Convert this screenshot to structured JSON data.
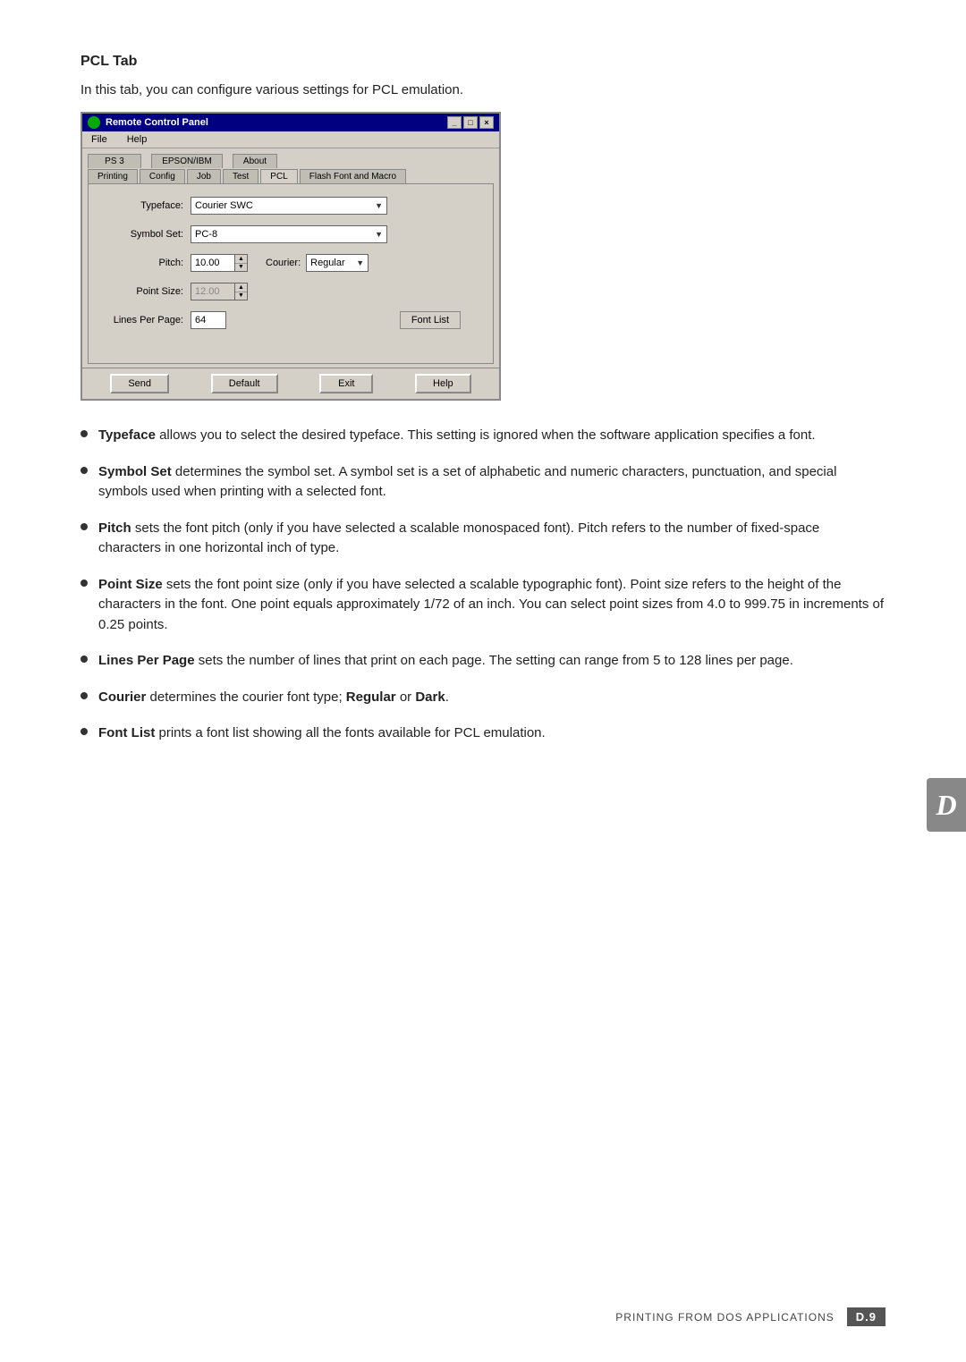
{
  "page": {
    "section_title": "PCL Tab",
    "intro": "In this tab, you can configure various settings for PCL emulation."
  },
  "window": {
    "title": "Remote Control Panel",
    "menu": [
      "File",
      "Help"
    ],
    "tabs_top": [
      "PS 3",
      "EPSON/IBM",
      "About"
    ],
    "tabs_bottom": [
      "Printing",
      "Config",
      "Job",
      "Test",
      "PCL",
      "Flash Font and Macro"
    ],
    "active_tab": "PCL",
    "fields": {
      "typeface_label": "Typeface:",
      "typeface_value": "Courier SWC",
      "symbol_set_label": "Symbol Set:",
      "symbol_set_value": "PC-8",
      "pitch_label": "Pitch:",
      "pitch_value": "10.00",
      "courier_label": "Courier:",
      "courier_value": "Regular",
      "point_size_label": "Point Size:",
      "point_size_value": "12.00",
      "lines_per_page_label": "Lines Per Page:",
      "lines_per_page_value": "64",
      "font_list_btn": "Font List"
    },
    "footer_buttons": [
      "Send",
      "Default",
      "Exit",
      "Help"
    ]
  },
  "bullets": [
    {
      "term": "Typeface",
      "text": " allows you to select the desired typeface. This setting is ignored when the software application specifies a font."
    },
    {
      "term": "Symbol Set",
      "text": " determines the symbol set. A symbol set is a set of alphabetic and numeric characters, punctuation, and special symbols used when printing with a selected font."
    },
    {
      "term": "Pitch",
      "text": " sets the font pitch (only if you have selected a scalable monospaced font). Pitch refers to the number of fixed-space characters in one horizontal inch of type."
    },
    {
      "term": "Point Size",
      "text": " sets the font point size (only if you have selected a scalable typographic font). Point size refers to the height of the characters in the font. One point equals approximately 1/72 of an inch. You can select point sizes from 4.0 to 999.75 in increments of 0.25 points."
    },
    {
      "term": "Lines Per Page",
      "text": " sets the number of lines that print on each page. The setting can range from 5 to 128 lines per page."
    },
    {
      "term": "Courier",
      "text": " determines the courier font type; ",
      "bold2": "Regular",
      "text2": " or ",
      "bold3": "Dark",
      "text3": "."
    },
    {
      "term": "Font List",
      "text": " prints a font list showing all the fonts available for PCL emulation."
    }
  ],
  "sidebar": {
    "letter": "D"
  },
  "footer": {
    "label": "Printing From DOS Applications",
    "page": "D.9"
  }
}
